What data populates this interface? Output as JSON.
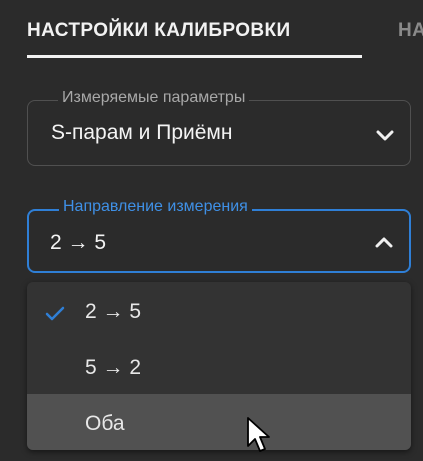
{
  "tabs": {
    "active": "НАСТРОЙКИ КАЛИБРОВКИ",
    "next": "НА"
  },
  "measured_params": {
    "legend": "Измеряемые параметры",
    "value": "S-парам и Приёмн"
  },
  "direction": {
    "legend": "Направление измерения",
    "value": "2 → 5",
    "options": [
      "2 → 5",
      "5 → 2",
      "Оба"
    ],
    "selected_index": 0,
    "hovered_index": 2
  },
  "colors": {
    "accent": "#2f7fd6",
    "background": "#2b2b2b",
    "dropdown": "#333333",
    "hover": "#515151"
  },
  "icons": {
    "collapsed_chevron": "chevron-down-icon",
    "expanded_chevron": "chevron-up-icon",
    "check": "check-icon",
    "cursor": "mouse-pointer-icon"
  }
}
